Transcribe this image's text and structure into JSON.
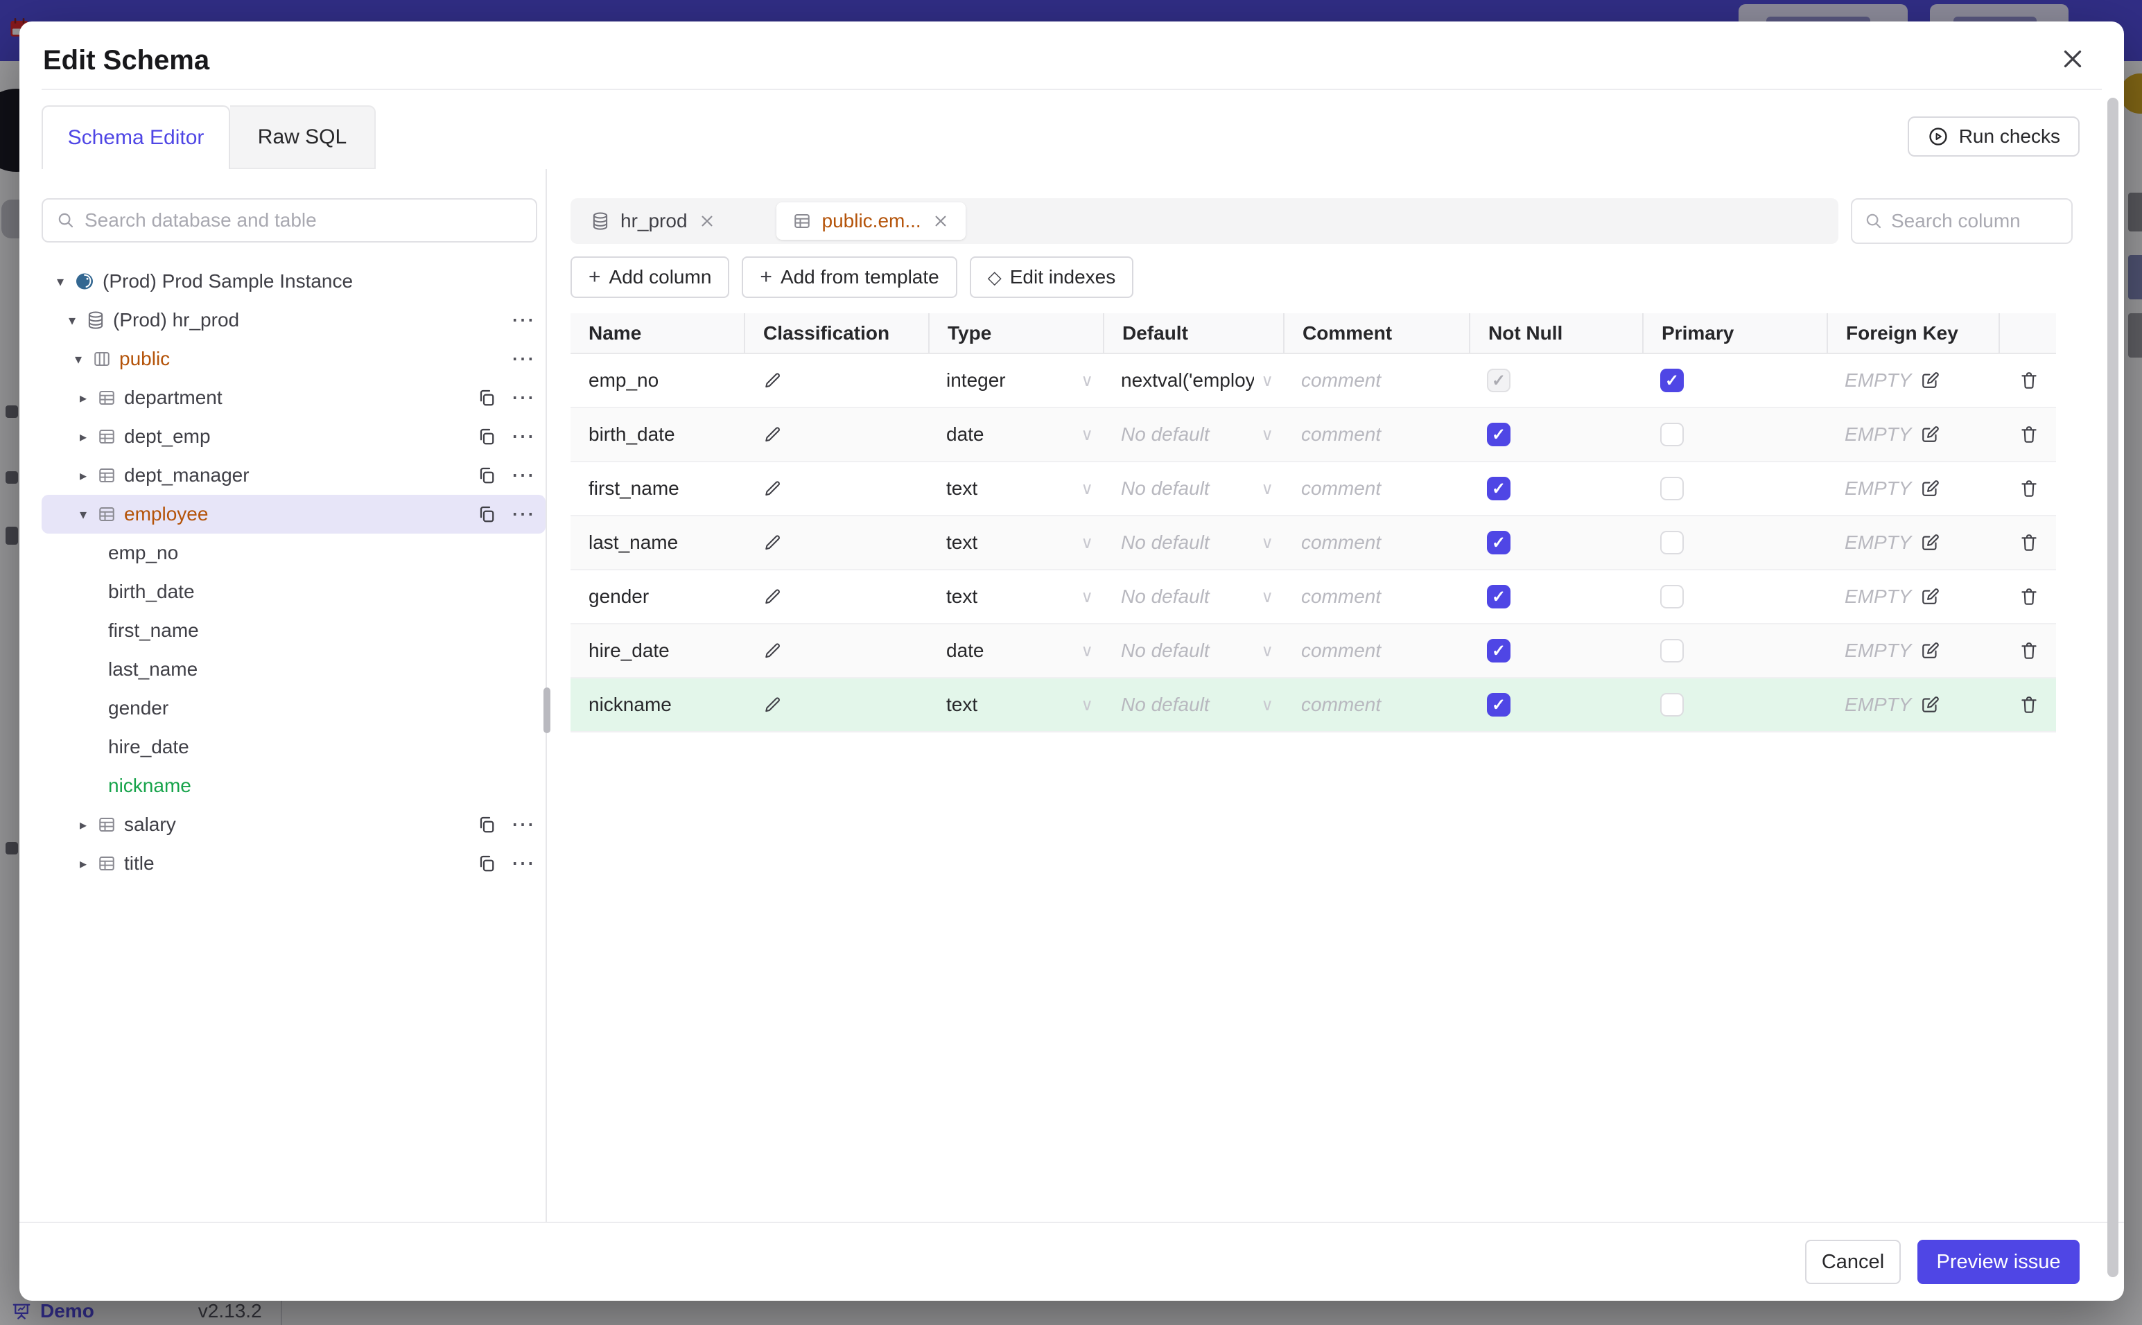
{
  "colors": {
    "accent_indigo": "#4f46e5",
    "topbar_purple": "#4c46d6",
    "schema_amber": "#b45309",
    "new_column_green": "#16a34a",
    "new_row_bg": "#e3f6ea",
    "selected_row_bg": "#e7e5f8"
  },
  "background": {
    "demo_label": "Demo",
    "version": "v2.13.2"
  },
  "modal": {
    "title": "Edit Schema",
    "tabs": [
      {
        "label": "Schema Editor"
      },
      {
        "label": "Raw SQL"
      }
    ],
    "run_checks_label": "Run checks",
    "footer": {
      "cancel_label": "Cancel",
      "submit_label": "Preview issue"
    }
  },
  "sidebar": {
    "search_placeholder": "Search database and table",
    "tree": [
      {
        "label": "(Prod) Prod Sample Instance",
        "type": "instance"
      },
      {
        "label": "(Prod) hr_prod",
        "type": "database"
      },
      {
        "label": "public",
        "type": "schema"
      },
      {
        "label": "department",
        "type": "table"
      },
      {
        "label": "dept_emp",
        "type": "table"
      },
      {
        "label": "dept_manager",
        "type": "table"
      },
      {
        "label": "employee",
        "type": "table",
        "selected": true
      },
      {
        "label": "emp_no",
        "type": "column"
      },
      {
        "label": "birth_date",
        "type": "column"
      },
      {
        "label": "first_name",
        "type": "column"
      },
      {
        "label": "last_name",
        "type": "column"
      },
      {
        "label": "gender",
        "type": "column"
      },
      {
        "label": "hire_date",
        "type": "column"
      },
      {
        "label": "nickname",
        "type": "column",
        "new": true
      },
      {
        "label": "salary",
        "type": "table"
      },
      {
        "label": "title",
        "type": "table"
      }
    ]
  },
  "main": {
    "chips": [
      {
        "label": "hr_prod",
        "icon": "database-icon"
      },
      {
        "label": "public.em...",
        "icon": "table-icon",
        "active": true
      }
    ],
    "column_search_placeholder": "Search column",
    "toolbar": [
      {
        "label": "Add column"
      },
      {
        "label": "Add from template"
      },
      {
        "label": "Edit indexes"
      }
    ],
    "table": {
      "headers": [
        "Name",
        "Classification",
        "Type",
        "Default",
        "Comment",
        "Not Null",
        "Primary",
        "Foreign Key"
      ],
      "comment_placeholder": "comment",
      "no_default_text": "No default",
      "fk_empty_text": "EMPTY",
      "rows": [
        {
          "name": "emp_no",
          "type": "integer",
          "default": "nextval('employ",
          "not_null": "checked-disabled",
          "primary": true
        },
        {
          "name": "birth_date",
          "type": "date",
          "default": "",
          "not_null": true,
          "primary": false
        },
        {
          "name": "first_name",
          "type": "text",
          "default": "",
          "not_null": true,
          "primary": false
        },
        {
          "name": "last_name",
          "type": "text",
          "default": "",
          "not_null": true,
          "primary": false
        },
        {
          "name": "gender",
          "type": "text",
          "default": "",
          "not_null": true,
          "primary": false
        },
        {
          "name": "hire_date",
          "type": "date",
          "default": "",
          "not_null": true,
          "primary": false
        },
        {
          "name": "nickname",
          "type": "text",
          "default": "",
          "not_null": true,
          "primary": false,
          "new": true
        }
      ]
    }
  },
  "icons": {
    "add": "+",
    "edit_indexes": "◇",
    "dots": "⋯",
    "chevron_down": "∨",
    "caret_down": "▾",
    "caret_right": "▸",
    "check": "✓"
  }
}
